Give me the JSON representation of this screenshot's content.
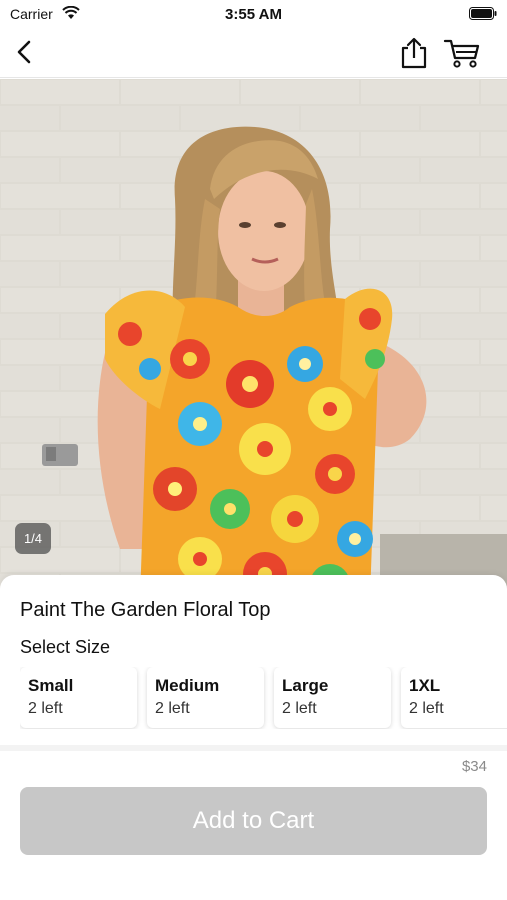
{
  "status_bar": {
    "carrier": "Carrier",
    "time": "3:55 AM"
  },
  "nav": {
    "back_icon": "chevron-left-icon",
    "share_icon": "share-icon",
    "cart_icon": "cart-icon"
  },
  "gallery": {
    "page_indicator": "1/4",
    "current_page": 1,
    "total_pages": 4
  },
  "product": {
    "title": "Paint The Garden Floral Top",
    "size_heading": "Select Size",
    "sizes": [
      {
        "name": "Small",
        "stock": "2 left"
      },
      {
        "name": "Medium",
        "stock": "2 left"
      },
      {
        "name": "Large",
        "stock": "2 left"
      },
      {
        "name": "1XL",
        "stock": "2 left"
      }
    ],
    "price": "$34",
    "add_to_cart_label": "Add to Cart"
  },
  "colors": {
    "button_disabled": "#c7c7c7",
    "price_text": "#8a8a8a",
    "indicator_bg": "#505050"
  }
}
